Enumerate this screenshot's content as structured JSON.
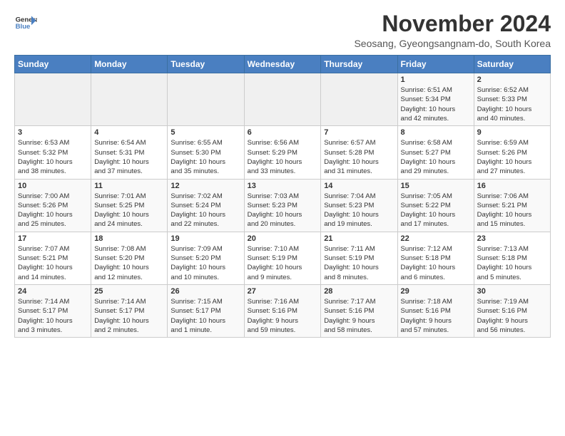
{
  "header": {
    "logo_line1": "General",
    "logo_line2": "Blue",
    "month_title": "November 2024",
    "subtitle": "Seosang, Gyeongsangnam-do, South Korea"
  },
  "days_of_week": [
    "Sunday",
    "Monday",
    "Tuesday",
    "Wednesday",
    "Thursday",
    "Friday",
    "Saturday"
  ],
  "weeks": [
    [
      {
        "day": "",
        "info": ""
      },
      {
        "day": "",
        "info": ""
      },
      {
        "day": "",
        "info": ""
      },
      {
        "day": "",
        "info": ""
      },
      {
        "day": "",
        "info": ""
      },
      {
        "day": "1",
        "info": "Sunrise: 6:51 AM\nSunset: 5:34 PM\nDaylight: 10 hours\nand 42 minutes."
      },
      {
        "day": "2",
        "info": "Sunrise: 6:52 AM\nSunset: 5:33 PM\nDaylight: 10 hours\nand 40 minutes."
      }
    ],
    [
      {
        "day": "3",
        "info": "Sunrise: 6:53 AM\nSunset: 5:32 PM\nDaylight: 10 hours\nand 38 minutes."
      },
      {
        "day": "4",
        "info": "Sunrise: 6:54 AM\nSunset: 5:31 PM\nDaylight: 10 hours\nand 37 minutes."
      },
      {
        "day": "5",
        "info": "Sunrise: 6:55 AM\nSunset: 5:30 PM\nDaylight: 10 hours\nand 35 minutes."
      },
      {
        "day": "6",
        "info": "Sunrise: 6:56 AM\nSunset: 5:29 PM\nDaylight: 10 hours\nand 33 minutes."
      },
      {
        "day": "7",
        "info": "Sunrise: 6:57 AM\nSunset: 5:28 PM\nDaylight: 10 hours\nand 31 minutes."
      },
      {
        "day": "8",
        "info": "Sunrise: 6:58 AM\nSunset: 5:27 PM\nDaylight: 10 hours\nand 29 minutes."
      },
      {
        "day": "9",
        "info": "Sunrise: 6:59 AM\nSunset: 5:26 PM\nDaylight: 10 hours\nand 27 minutes."
      }
    ],
    [
      {
        "day": "10",
        "info": "Sunrise: 7:00 AM\nSunset: 5:26 PM\nDaylight: 10 hours\nand 25 minutes."
      },
      {
        "day": "11",
        "info": "Sunrise: 7:01 AM\nSunset: 5:25 PM\nDaylight: 10 hours\nand 24 minutes."
      },
      {
        "day": "12",
        "info": "Sunrise: 7:02 AM\nSunset: 5:24 PM\nDaylight: 10 hours\nand 22 minutes."
      },
      {
        "day": "13",
        "info": "Sunrise: 7:03 AM\nSunset: 5:23 PM\nDaylight: 10 hours\nand 20 minutes."
      },
      {
        "day": "14",
        "info": "Sunrise: 7:04 AM\nSunset: 5:23 PM\nDaylight: 10 hours\nand 19 minutes."
      },
      {
        "day": "15",
        "info": "Sunrise: 7:05 AM\nSunset: 5:22 PM\nDaylight: 10 hours\nand 17 minutes."
      },
      {
        "day": "16",
        "info": "Sunrise: 7:06 AM\nSunset: 5:21 PM\nDaylight: 10 hours\nand 15 minutes."
      }
    ],
    [
      {
        "day": "17",
        "info": "Sunrise: 7:07 AM\nSunset: 5:21 PM\nDaylight: 10 hours\nand 14 minutes."
      },
      {
        "day": "18",
        "info": "Sunrise: 7:08 AM\nSunset: 5:20 PM\nDaylight: 10 hours\nand 12 minutes."
      },
      {
        "day": "19",
        "info": "Sunrise: 7:09 AM\nSunset: 5:20 PM\nDaylight: 10 hours\nand 10 minutes."
      },
      {
        "day": "20",
        "info": "Sunrise: 7:10 AM\nSunset: 5:19 PM\nDaylight: 10 hours\nand 9 minutes."
      },
      {
        "day": "21",
        "info": "Sunrise: 7:11 AM\nSunset: 5:19 PM\nDaylight: 10 hours\nand 8 minutes."
      },
      {
        "day": "22",
        "info": "Sunrise: 7:12 AM\nSunset: 5:18 PM\nDaylight: 10 hours\nand 6 minutes."
      },
      {
        "day": "23",
        "info": "Sunrise: 7:13 AM\nSunset: 5:18 PM\nDaylight: 10 hours\nand 5 minutes."
      }
    ],
    [
      {
        "day": "24",
        "info": "Sunrise: 7:14 AM\nSunset: 5:17 PM\nDaylight: 10 hours\nand 3 minutes."
      },
      {
        "day": "25",
        "info": "Sunrise: 7:14 AM\nSunset: 5:17 PM\nDaylight: 10 hours\nand 2 minutes."
      },
      {
        "day": "26",
        "info": "Sunrise: 7:15 AM\nSunset: 5:17 PM\nDaylight: 10 hours\nand 1 minute."
      },
      {
        "day": "27",
        "info": "Sunrise: 7:16 AM\nSunset: 5:16 PM\nDaylight: 9 hours\nand 59 minutes."
      },
      {
        "day": "28",
        "info": "Sunrise: 7:17 AM\nSunset: 5:16 PM\nDaylight: 9 hours\nand 58 minutes."
      },
      {
        "day": "29",
        "info": "Sunrise: 7:18 AM\nSunset: 5:16 PM\nDaylight: 9 hours\nand 57 minutes."
      },
      {
        "day": "30",
        "info": "Sunrise: 7:19 AM\nSunset: 5:16 PM\nDaylight: 9 hours\nand 56 minutes."
      }
    ]
  ]
}
